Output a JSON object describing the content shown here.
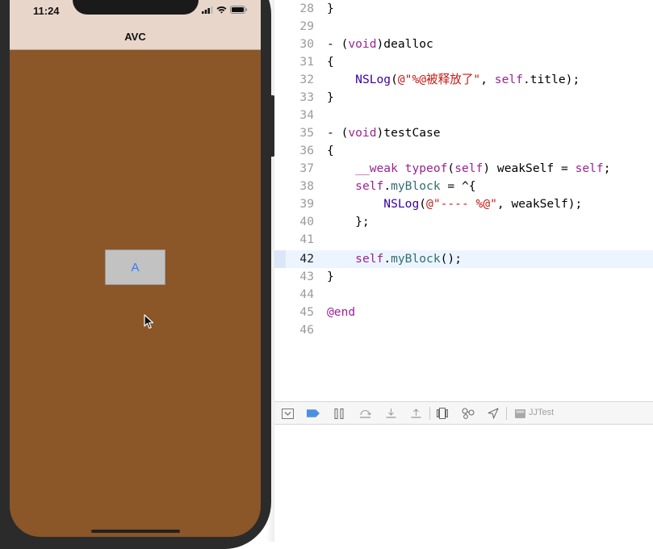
{
  "simulator": {
    "time": "11:24",
    "nav_title": "AVC",
    "button_label": "A",
    "colors": {
      "view_bg": "#8b5628",
      "nav_bg": "#e9d6cb",
      "button_text": "#2f7bf5"
    },
    "icons": [
      "cellular-icon",
      "wifi-icon",
      "battery-icon",
      "mouse-cursor-icon"
    ]
  },
  "editor": {
    "current_line": "42",
    "lines": [
      {
        "num": "28",
        "code": "}"
      },
      {
        "num": "29",
        "code": ""
      },
      {
        "num": "30",
        "code": "- (void)dealloc"
      },
      {
        "num": "31",
        "code": "{"
      },
      {
        "num": "32",
        "code": "    NSLog(@\"%@被释放了\", self.title);"
      },
      {
        "num": "33",
        "code": "}"
      },
      {
        "num": "34",
        "code": ""
      },
      {
        "num": "35",
        "code": "- (void)testCase"
      },
      {
        "num": "36",
        "code": "{"
      },
      {
        "num": "37",
        "code": "    __weak typeof(self) weakSelf = self;"
      },
      {
        "num": "38",
        "code": "    self.myBlock = ^{"
      },
      {
        "num": "39",
        "code": "        NSLog(@\"---- %@\", weakSelf);"
      },
      {
        "num": "40",
        "code": "    };"
      },
      {
        "num": "41",
        "code": ""
      },
      {
        "num": "42",
        "code": "    self.myBlock();"
      },
      {
        "num": "43",
        "code": "}"
      },
      {
        "num": "44",
        "code": ""
      },
      {
        "num": "45",
        "code": "@end"
      },
      {
        "num": "46",
        "code": ""
      }
    ]
  },
  "debug_bar": {
    "target_label": "JJTest",
    "icons": [
      "hide-console-icon",
      "breakpoint-toggle-icon",
      "pause-icon",
      "step-over-icon",
      "step-into-icon",
      "step-out-icon",
      "view-debugger-icon",
      "memory-graph-icon",
      "location-icon",
      "target-app-icon"
    ]
  }
}
